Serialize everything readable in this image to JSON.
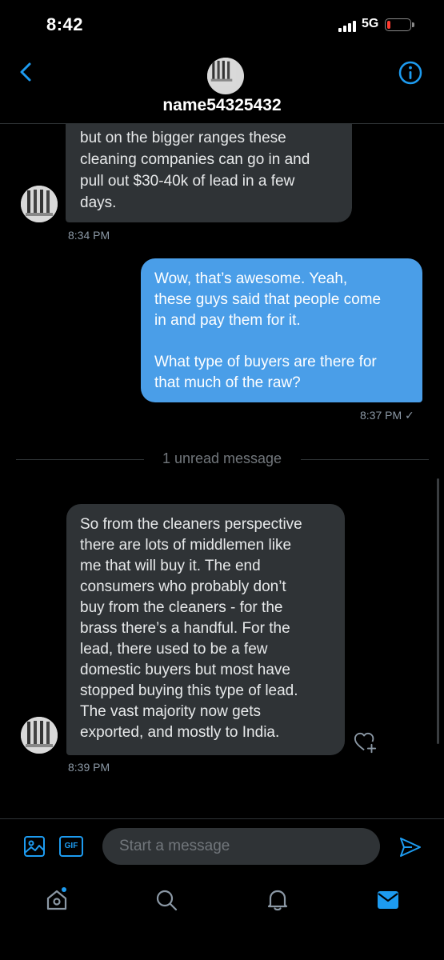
{
  "status": {
    "time": "8:42",
    "network": "5G"
  },
  "header": {
    "username": "name54325432"
  },
  "messages": {
    "first_in": {
      "lines": [
        "but on the bigger ranges these",
        "cleaning companies can go in and",
        "pull out $30-40k of lead in a few",
        "days."
      ],
      "time": "8:34 PM"
    },
    "out": {
      "lines": [
        "Wow, that’s awesome. Yeah,",
        "these guys said that people come",
        "in and pay them for it.",
        "",
        "What type of buyers are there for",
        "that much of the raw?"
      ],
      "time": "8:37 PM ✓"
    },
    "unread_label": "1 unread message",
    "second_in": {
      "lines": [
        "So from the cleaners perspective",
        "there are lots of middlemen like",
        "me that will buy it. The end",
        "consumers who probably don’t",
        "buy from the cleaners - for the",
        "brass there’s a handful. For the",
        "lead, there used to be a few",
        "domestic buyers but most have",
        "stopped buying this type of lead.",
        "The vast majority now gets",
        "exported, and mostly to India."
      ],
      "time": "8:39 PM"
    }
  },
  "composer": {
    "placeholder": "Start a message",
    "gif_label": "GIF"
  },
  "tabs": [
    "home-icon",
    "search-icon",
    "notifications-icon",
    "messages-icon"
  ],
  "colors": {
    "accent": "#1d9bf0",
    "bubble_in": "#2f3336",
    "bubble_out": "#4a9ee8",
    "battery_low": "#ff3b30"
  }
}
